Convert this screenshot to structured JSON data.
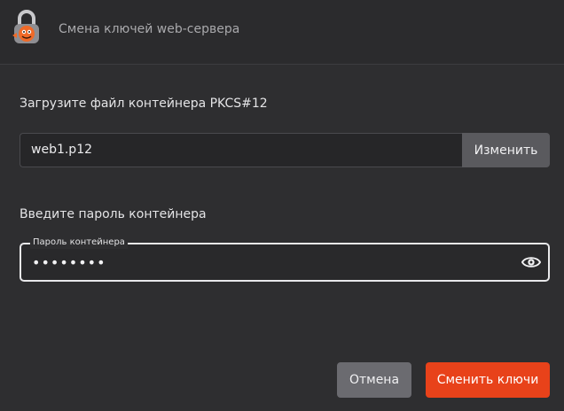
{
  "window": {
    "title": "Смена ключей web-сервера",
    "app_icon": "padlock-logo-icon"
  },
  "file_section": {
    "label": "Загрузите файл контейнера PKCS#12",
    "file_name": "web1.p12",
    "change_label": "Изменить"
  },
  "password_section": {
    "label": "Введите пароль контейнера",
    "field_legend": "Пароль контейнера",
    "masked_value": "••••••••",
    "toggle_icon": "eye-icon"
  },
  "actions": {
    "cancel_label": "Отмена",
    "submit_label": "Сменить ключи"
  },
  "colors": {
    "background": "#2e2e30",
    "accent": "#e8421a",
    "secondary_button": "#6b6b70"
  }
}
